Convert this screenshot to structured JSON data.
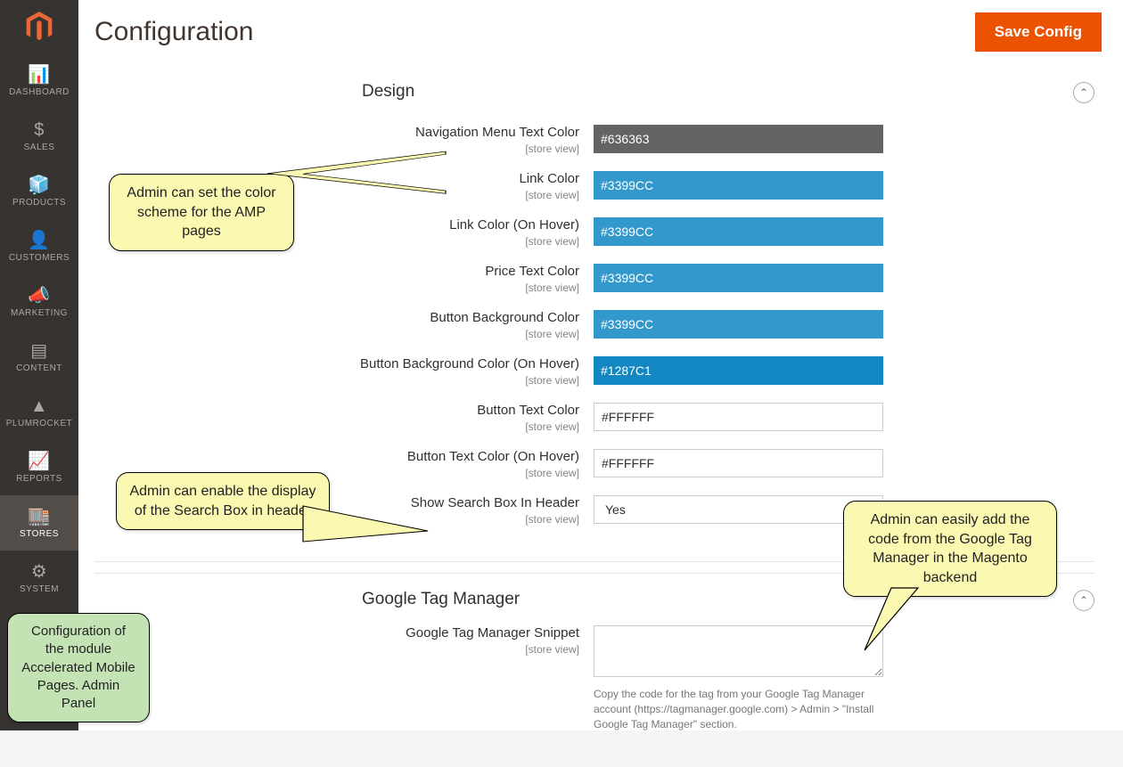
{
  "page": {
    "title": "Configuration",
    "save_label": "Save Config"
  },
  "sidebar": {
    "items": [
      {
        "label": "DASHBOARD",
        "icon": "📊"
      },
      {
        "label": "SALES",
        "icon": "$"
      },
      {
        "label": "PRODUCTS",
        "icon": "🧊"
      },
      {
        "label": "CUSTOMERS",
        "icon": "👤"
      },
      {
        "label": "MARKETING",
        "icon": "📣"
      },
      {
        "label": "CONTENT",
        "icon": "▤"
      },
      {
        "label": "PLUMROCKET",
        "icon": "▲"
      },
      {
        "label": "REPORTS",
        "icon": "📈"
      },
      {
        "label": "STORES",
        "icon": "🏬"
      },
      {
        "label": "SYSTEM",
        "icon": "⚙"
      }
    ]
  },
  "sections": {
    "design": {
      "title": "Design",
      "fields": {
        "nav_menu_text_color": {
          "label": "Navigation Menu Text Color",
          "scope": "[store view]",
          "value": "#636363",
          "bg": "#636363"
        },
        "link_color": {
          "label": "Link Color",
          "scope": "[store view]",
          "value": "#3399CC",
          "bg": "#3399CC"
        },
        "link_color_hover": {
          "label": "Link Color (On Hover)",
          "scope": "[store view]",
          "value": "#3399CC",
          "bg": "#3399CC"
        },
        "price_text_color": {
          "label": "Price Text Color",
          "scope": "[store view]",
          "value": "#3399CC",
          "bg": "#3399CC"
        },
        "button_bg_color": {
          "label": "Button Background Color",
          "scope": "[store view]",
          "value": "#3399CC",
          "bg": "#3399CC"
        },
        "button_bg_color_hover": {
          "label": "Button Background Color (On Hover)",
          "scope": "[store view]",
          "value": "#1287C1",
          "bg": "#1287C1"
        },
        "button_text_color": {
          "label": "Button Text Color",
          "scope": "[store view]",
          "value": "#FFFFFF",
          "bg": ""
        },
        "button_text_color_hover": {
          "label": "Button Text Color (On Hover)",
          "scope": "[store view]",
          "value": "#FFFFFF",
          "bg": ""
        },
        "show_search": {
          "label": "Show Search Box In Header",
          "scope": "[store view]",
          "value": "Yes"
        }
      }
    },
    "gtm": {
      "title": "Google Tag Manager",
      "fields": {
        "snippet": {
          "label": "Google Tag Manager Snippet",
          "scope": "[store view]",
          "value": ""
        }
      },
      "note": "Copy the code for the tag from your Google Tag Manager account (https://tagmanager.google.com) > Admin > \"Install Google Tag Manager\" section."
    }
  },
  "callouts": {
    "colors": "Admin can set the color scheme for the AMP pages",
    "search": "Admin can enable the display of the Search Box in header",
    "gtm": "Admin can easily add the code from the Google Tag Manager in the Magento backend",
    "module": "Configuration of the module Accelerated Mobile Pages. Admin Panel"
  }
}
